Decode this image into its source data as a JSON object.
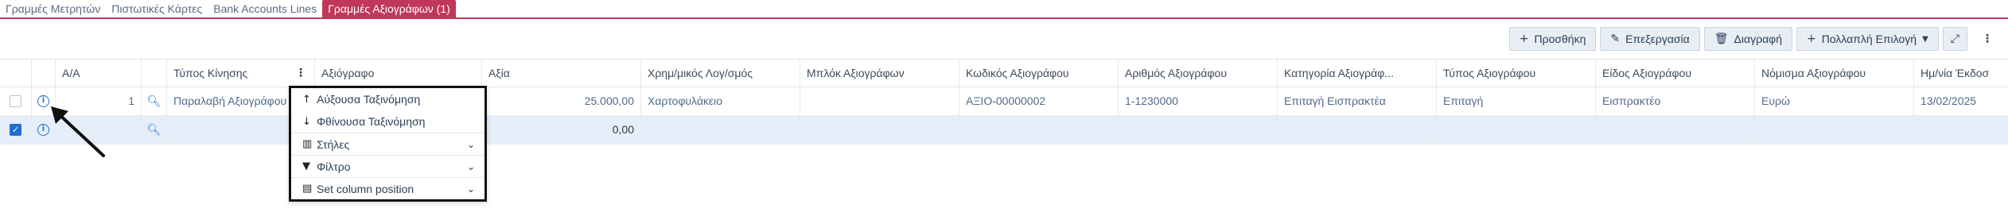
{
  "tabs": [
    {
      "label": "Γραμμές Μετρητών"
    },
    {
      "label": "Πιστωτικές Κάρτες"
    },
    {
      "label": "Bank Accounts Lines"
    },
    {
      "label": "Γραμμές Αξιογράφων (1)"
    }
  ],
  "toolbar": {
    "add_label": "Προσθήκη",
    "edit_label": "Επεξεργασία",
    "delete_label": "Διαγραφή",
    "multi_label": "Πολλαπλή Επιλογή"
  },
  "grid": {
    "columns": [
      "A/A",
      "Τύπος Κίνησης",
      "Αξιόγραφο",
      "Αξία",
      "Χρημ/μικός Λογ/σμός",
      "Μπλόκ Αξιογράφων",
      "Κωδικός Αξιογράφου",
      "Αριθμός Αξιογράφου",
      "Κατηγορία Αξιογράφ...",
      "Τύπος Αξιογράφου",
      "Είδος Αξιογράφου",
      "Νόμισμα Αξιογράφου",
      "Ημ/νία Έκδοσ"
    ],
    "rows": [
      {
        "aa": "1",
        "tipos_kinisis": "Παραλαβή Αξιογράφου",
        "axiografo": "",
        "axia": "25.000,00",
        "logariasmos": "Χαρτοφυλάκειο",
        "mplok": "",
        "kodikos": "ΑΞΙΟ-00000002",
        "arithmos": "1-1230000",
        "katigoria": "Επιταγή Εισπρακτέα",
        "typos": "Επιταγή",
        "eidos": "Εισπρακτέο",
        "nomisma": "Ευρώ",
        "imnia": "13/02/2025"
      },
      {
        "aa": "",
        "tipos_kinisis": "",
        "axiografo": "",
        "axia": "0,00",
        "logariasmos": "",
        "mplok": "",
        "kodikos": "",
        "arithmos": "",
        "katigoria": "",
        "typos": "",
        "eidos": "",
        "nomisma": "",
        "imnia": ""
      }
    ]
  },
  "column_menu": {
    "sort_asc": "Αύξουσα Ταξινόμηση",
    "sort_desc": "Φθίνουσα Ταξινόμηση",
    "columns": "Στήλες",
    "filter": "Φίλτρο",
    "set_position": "Set column position"
  },
  "colors": {
    "accent": "#c0375b",
    "link": "#1f6fd1",
    "selected_row": "#e6eff9"
  }
}
